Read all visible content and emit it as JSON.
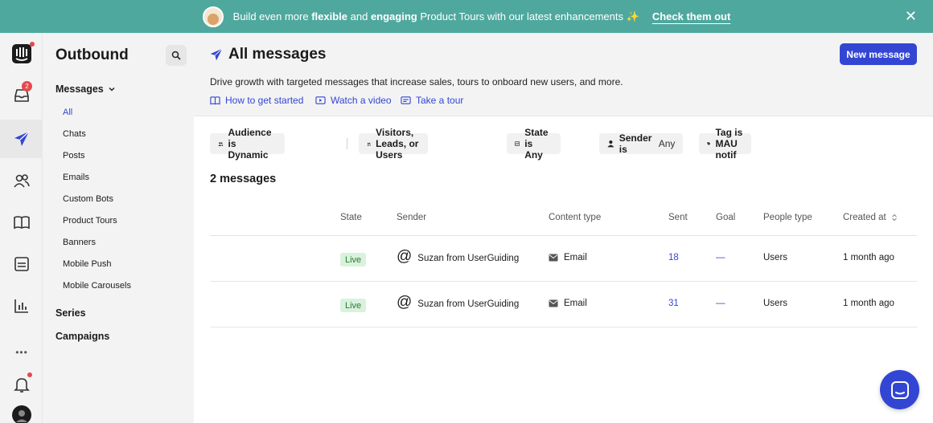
{
  "banner": {
    "text_prefix": "Build even more ",
    "text_bold1": "flexible",
    "text_mid": " and ",
    "text_bold2": "engaging",
    "text_suffix": " Product Tours with our latest enhancements ✨",
    "cta": "Check them out",
    "close": "✕"
  },
  "rail": {
    "inbox_badge": "2",
    "more": "•••"
  },
  "sidebar": {
    "title": "Outbound",
    "messages_label": "Messages",
    "items": [
      {
        "label": "All"
      },
      {
        "label": "Chats"
      },
      {
        "label": "Posts"
      },
      {
        "label": "Emails"
      },
      {
        "label": "Custom Bots"
      },
      {
        "label": "Product Tours"
      },
      {
        "label": "Banners"
      },
      {
        "label": "Mobile Push"
      },
      {
        "label": "Mobile Carousels"
      }
    ],
    "series_label": "Series",
    "campaigns_label": "Campaigns"
  },
  "header": {
    "title": "All messages",
    "new_button": "New message",
    "description": "Drive growth with targeted messages that increase sales, tours to onboard new users, and more.",
    "links": [
      {
        "label": "How to get started"
      },
      {
        "label": "Watch a video"
      },
      {
        "label": "Take a tour"
      }
    ]
  },
  "filters": {
    "audience": "Audience is Dynamic",
    "people": "Visitors, Leads, or Users",
    "state": "State is Any",
    "sender_bold": "Sender is",
    "sender_value": "Any",
    "tag": "Tag is MAU notif"
  },
  "count": "2 messages",
  "table": {
    "headers": {
      "state": "State",
      "sender": "Sender",
      "content_type": "Content type",
      "sent": "Sent",
      "goal": "Goal",
      "people_type": "People type",
      "created_at": "Created at"
    },
    "rows": [
      {
        "state": "Live",
        "sender": "Suzan from UserGuiding",
        "content_type": "Email",
        "sent": "18",
        "goal": "—",
        "people_type": "Users",
        "created_at": "1 month ago"
      },
      {
        "state": "Live",
        "sender": "Suzan from UserGuiding",
        "content_type": "Email",
        "sent": "31",
        "goal": "—",
        "people_type": "Users",
        "created_at": "1 month ago"
      }
    ]
  },
  "colors": {
    "banner": "#4fa89e",
    "accent": "#3346d3",
    "live_bg": "#d9f2dc",
    "live_text": "#2b7a35"
  }
}
